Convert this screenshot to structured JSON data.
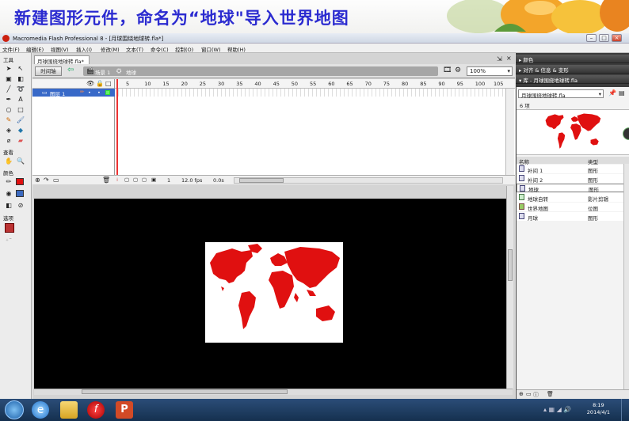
{
  "slide": {
    "title": "新建图形元件，命名为“地球\"导入世界地图"
  },
  "window": {
    "title": "Macromedia Flash Professional 8 - [月球围绕地球转.fla*]"
  },
  "menus": [
    "文件(F)",
    "编辑(E)",
    "视图(V)",
    "插入(I)",
    "修改(M)",
    "文本(T)",
    "命令(C)",
    "控制(O)",
    "窗口(W)",
    "帮助(H)"
  ],
  "toolbox": {
    "tools_label": "工具",
    "view_label": "查看",
    "colors_label": "颜色",
    "options_label": "选项"
  },
  "document": {
    "tab": "月球围绕地球转.fla*",
    "timeline_button": "时间轴",
    "scene": "场景 1",
    "symbol": "地球",
    "zoom": "100%"
  },
  "timeline": {
    "layer_name": "图层 1",
    "frame_numbers": [
      "5",
      "10",
      "15",
      "20",
      "25",
      "30",
      "35",
      "40",
      "45",
      "50",
      "55",
      "60",
      "65",
      "70",
      "75",
      "80",
      "85",
      "90",
      "95",
      "100",
      "105"
    ],
    "current_frame": "1",
    "fps": "12.0 fps",
    "time": "0.0s"
  },
  "panels": {
    "color": "颜色",
    "align": "对齐 & 信息 & 变形",
    "library": "库 - 月球围绕地球转.fla"
  },
  "library": {
    "file_select": "月球围绕地球转.fla",
    "count": "6 项",
    "col_name": "名称",
    "col_type": "类型",
    "items": [
      {
        "name": "补间 1",
        "type": "图形"
      },
      {
        "name": "补间 2",
        "type": "图形"
      },
      {
        "name": "地球",
        "type": "图形"
      },
      {
        "name": "地球自转",
        "type": "影片剪辑"
      },
      {
        "name": "世界地图",
        "type": "位图"
      },
      {
        "name": "月球",
        "type": "图形"
      }
    ]
  },
  "taskbar": {
    "time": "8:19",
    "date": "2014/4/1"
  },
  "colors": {
    "title_blue": "#2b2bd0",
    "selection": "#3869c8",
    "map_red": "#e01010",
    "stage_bg": "#000000"
  }
}
